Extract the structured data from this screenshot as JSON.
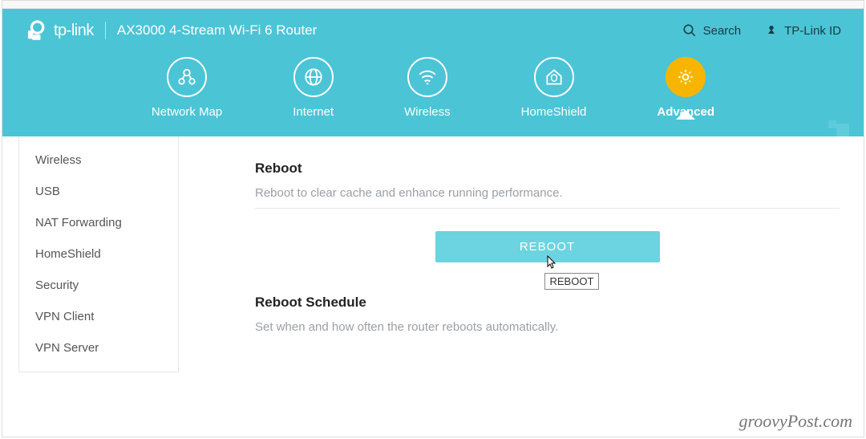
{
  "brand": {
    "name": "tp-link",
    "model": "AX3000 4-Stream Wi-Fi 6 Router"
  },
  "actions": {
    "search": "Search",
    "id": "TP-Link ID"
  },
  "nav": {
    "items": [
      {
        "label": "Network Map"
      },
      {
        "label": "Internet"
      },
      {
        "label": "Wireless"
      },
      {
        "label": "HomeShield"
      },
      {
        "label": "Advanced"
      }
    ]
  },
  "sidebar": {
    "items": [
      {
        "label": "Wireless"
      },
      {
        "label": "USB"
      },
      {
        "label": "NAT Forwarding"
      },
      {
        "label": "HomeShield"
      },
      {
        "label": "Security"
      },
      {
        "label": "VPN Client"
      },
      {
        "label": "VPN Server"
      }
    ]
  },
  "main": {
    "reboot_title": "Reboot",
    "reboot_desc": "Reboot to clear cache and enhance running performance.",
    "reboot_button": "REBOOT",
    "reboot_tooltip": "REBOOT",
    "schedule_title": "Reboot Schedule",
    "schedule_desc": "Set when and how often the router reboots automatically."
  },
  "watermark": "groovyPost.com"
}
